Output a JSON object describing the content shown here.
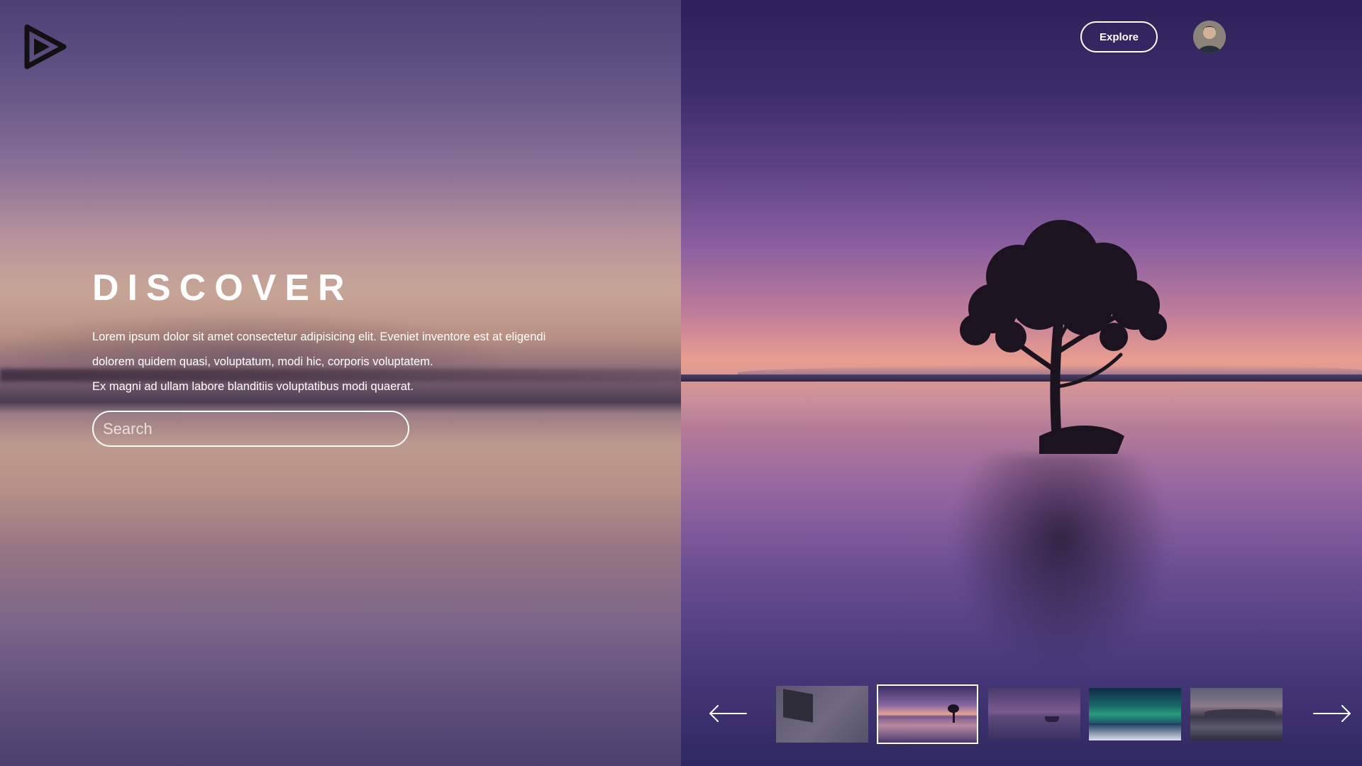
{
  "hero": {
    "title": "DISCOVER",
    "paragraph_lines": [
      "Lorem ipsum dolor sit amet consectetur adipisicing elit. Eveniet inventore est at eligendi",
      "dolorem quidem quasi, voluptatum, modi hic, corporis voluptatem.",
      "Ex magni ad ullam labore blanditiis voluptatibus modi quaerat."
    ]
  },
  "search": {
    "placeholder": "Search"
  },
  "header": {
    "explore_label": "Explore"
  },
  "icons": {
    "logo": "play-triangle-logo-icon",
    "prev": "arrow-left-icon",
    "next": "arrow-right-icon",
    "avatar": "user-avatar"
  },
  "gallery": {
    "selected_index": 1,
    "thumbnails": [
      "thumbnail-dark-laptop",
      "thumbnail-tree-sunset",
      "thumbnail-boat-lake",
      "thumbnail-aurora",
      "thumbnail-mountain-coast"
    ]
  },
  "colors": {
    "accent": "#ffffff",
    "sky_top": "#2c215a",
    "sunset": "#e89d8f"
  }
}
